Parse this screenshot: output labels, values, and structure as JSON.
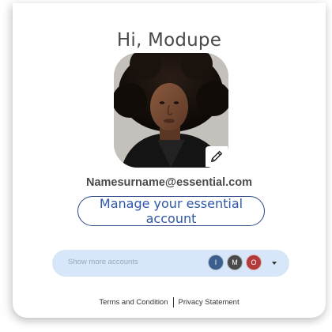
{
  "greeting": "Hi, Modupe",
  "email": "Namesurname@essential.com",
  "manage_account_label": "Manage your essential account",
  "more_accounts": {
    "label": "Show more accounts",
    "avatars": [
      {
        "initial": "I",
        "color": "#3b5e8c"
      },
      {
        "initial": "M",
        "color": "#4a4a4a"
      },
      {
        "initial": "O",
        "color": "#b23a3a"
      }
    ]
  },
  "footer": {
    "terms": "Terms and Condition",
    "privacy": "Privacy Statement"
  },
  "colors": {
    "accent": "#2f57a8",
    "accounts_bg": "#d8e6f9"
  },
  "icons": {
    "edit": "pencil-icon",
    "dropdown": "caret-down-icon"
  }
}
